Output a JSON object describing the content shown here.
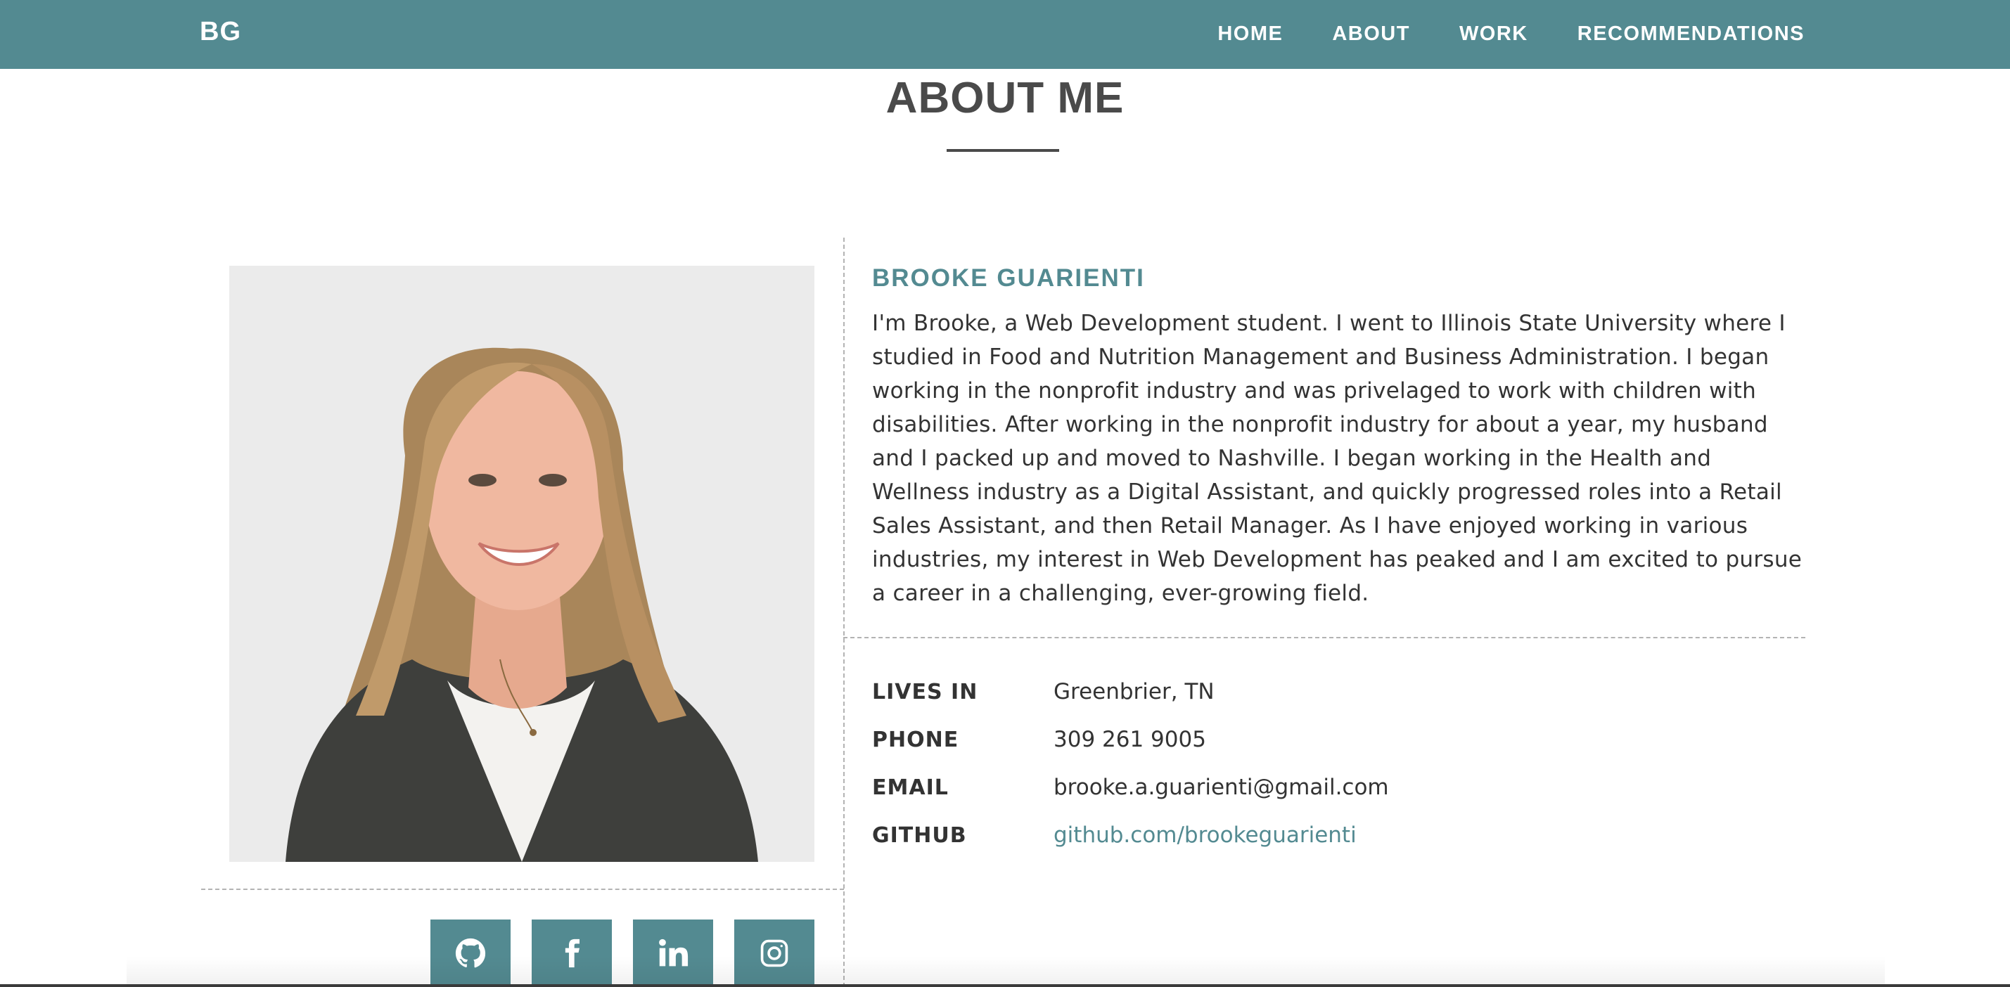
{
  "navbar": {
    "brand": "BG",
    "links": [
      {
        "label": "HOME"
      },
      {
        "label": "ABOUT"
      },
      {
        "label": "WORK"
      },
      {
        "label": "RECOMMENDATIONS"
      }
    ],
    "background_color": "#538a91"
  },
  "section": {
    "title": "ABOUT ME"
  },
  "profile": {
    "name": "BROOKE GUARIENTI",
    "bio": "I'm Brooke, a Web Development student. I went to Illinois State University where I studied in Food and Nutrition Management and Business Administration. I began working in the nonprofit industry and was privelaged to work with children with disabilities. After working in the nonprofit industry for about a year, my husband and I packed up and moved to Nashville. I began working in the Health and Wellness industry as a Digital Assistant, and quickly progressed roles into a Retail Sales Assistant, and then Retail Manager. As I have enjoyed working in various industries, my interest in Web Development has peaked and I am excited to pursue a career in a challenging, ever-growing field.",
    "accent_color": "#538a91"
  },
  "info": [
    {
      "label": "LIVES IN",
      "value": "Greenbrier, TN"
    },
    {
      "label": "PHONE",
      "value": "309 261 9005"
    },
    {
      "label": "EMAIL",
      "value": "brooke.a.guarienti@gmail.com"
    },
    {
      "label": "GITHUB",
      "value": "github.com/brookeguarienti"
    }
  ],
  "social": [
    {
      "icon": "github-icon"
    },
    {
      "icon": "facebook-icon"
    },
    {
      "icon": "linkedin-icon"
    },
    {
      "icon": "instagram-icon"
    }
  ]
}
